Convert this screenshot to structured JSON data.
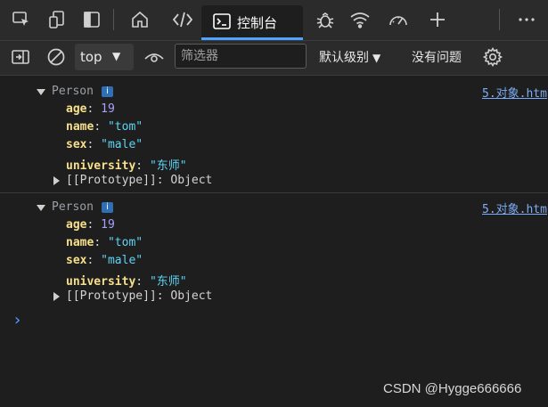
{
  "tabbar": {
    "console_tab_label": "控制台"
  },
  "toolbar": {
    "context_value": "top",
    "filter_placeholder": "筛选器",
    "levels_label": "默认级别",
    "issues_label": "没有问题"
  },
  "entries": [
    {
      "object_name": "Person",
      "source": "5.对象.htm",
      "props": [
        {
          "key": "age",
          "value": "19",
          "type": "number"
        },
        {
          "key": "name",
          "value": "\"tom\"",
          "type": "string"
        },
        {
          "key": "sex",
          "value": "\"male\"",
          "type": "string"
        },
        {
          "key": "university",
          "value": "\"东师\"",
          "type": "string"
        }
      ],
      "prototype_label": "[[Prototype]]",
      "prototype_value": "Object"
    },
    {
      "object_name": "Person",
      "source": "5.对象.htm",
      "props": [
        {
          "key": "age",
          "value": "19",
          "type": "number"
        },
        {
          "key": "name",
          "value": "\"tom\"",
          "type": "string"
        },
        {
          "key": "sex",
          "value": "\"male\"",
          "type": "string"
        },
        {
          "key": "university",
          "value": "\"东师\"",
          "type": "string"
        }
      ],
      "prototype_label": "[[Prototype]]",
      "prototype_value": "Object"
    }
  ],
  "info_badge": "i",
  "prompt_symbol": "›",
  "watermark": "CSDN @Hygge666666",
  "colors": {
    "accent": "#4da3ff",
    "key": "#f7e08a",
    "number": "#a8a2ff",
    "string": "#5fd4f4",
    "link": "#7cacf8"
  }
}
